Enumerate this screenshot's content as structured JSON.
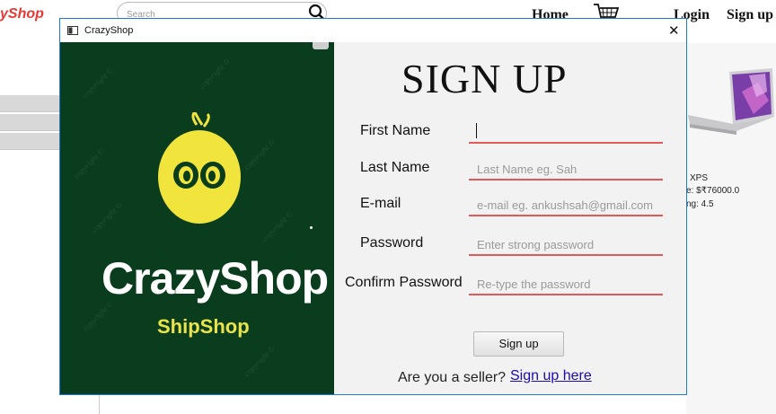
{
  "background": {
    "logo": "yShop",
    "search_placeholder": "Search",
    "nav": {
      "home": "Home",
      "login": "Login",
      "signup": "Sign up"
    },
    "product": {
      "name": "XPS",
      "price": "e: $₹76000.0",
      "rating": "ng: 4.5"
    }
  },
  "window": {
    "title": "CrazyShop",
    "close": "✕"
  },
  "branding": {
    "name": "CrazyShop",
    "tagline": "ShipShop",
    "watermark": "copyright ©"
  },
  "form": {
    "heading": "SIGN UP",
    "fields": [
      {
        "label": "First Name",
        "placeholder": "",
        "value": ""
      },
      {
        "label": "Last Name",
        "placeholder": "Last Name eg. Sah",
        "value": ""
      },
      {
        "label": "E-mail",
        "placeholder": "e-mail eg. ankushsah@gmail.com",
        "value": ""
      },
      {
        "label": "Password",
        "placeholder": "Enter strong password",
        "value": ""
      },
      {
        "label": "Confirm Password",
        "placeholder": "Re-type the password",
        "value": ""
      }
    ],
    "submit_label": "Sign up",
    "seller_prompt": "Are you a seller?",
    "seller_link": "Sign up here"
  },
  "colors": {
    "window_border": "#1f7ad6",
    "brand_panel": "#093d1d",
    "mascot_yellow": "#f1e43c",
    "field_underline": "#e05a5a",
    "link": "#1a0dab",
    "logo_red": "#e53935"
  }
}
